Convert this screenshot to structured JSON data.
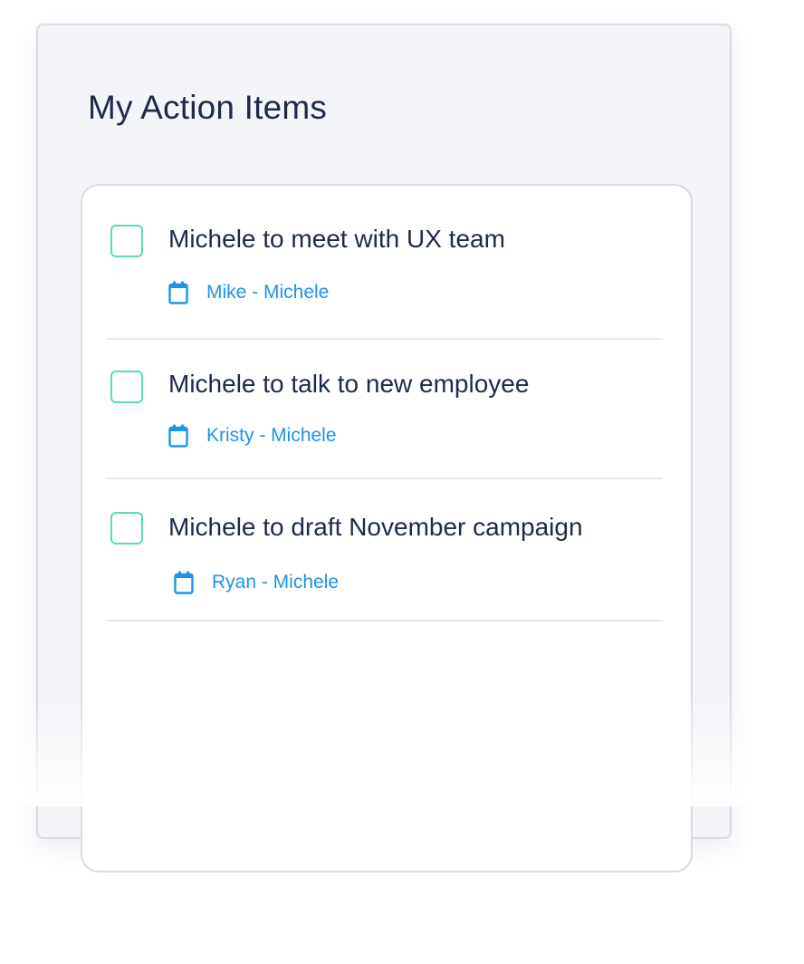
{
  "panel": {
    "title": "My Action Items"
  },
  "items": [
    {
      "title": "Michele to meet with UX team",
      "meta": "Mike - Michele",
      "icon": "calendar-icon"
    },
    {
      "title": "Michele to talk to new employee",
      "meta": "Kristy - Michele",
      "icon": "calendar-icon"
    },
    {
      "title": "Michele to draft November campaign",
      "meta": "Ryan - Michele",
      "icon": "calendar-icon"
    }
  ],
  "colors": {
    "checkbox_border": "#57dcb7",
    "meta_text": "#1c94e8",
    "title_text": "#1e2a4a",
    "panel_bg": "#f4f5f9"
  }
}
